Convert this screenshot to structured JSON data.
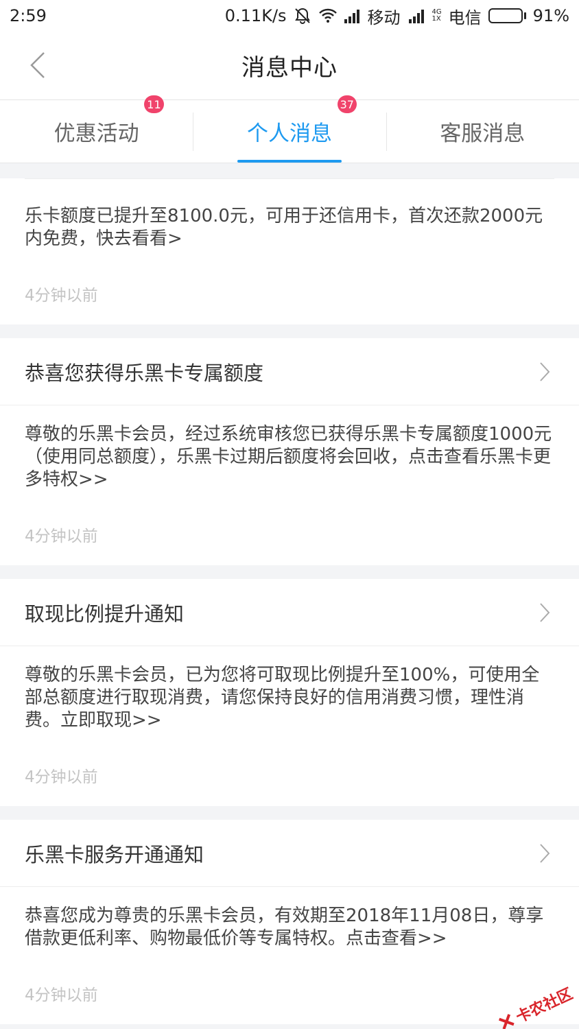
{
  "status_bar": {
    "time": "2:59",
    "speed": "0.11K/s",
    "carrier1": "移动",
    "net_tag_top": "4G",
    "net_tag_bottom": "1X",
    "carrier2": "电信",
    "battery": "91%",
    "battery_level": 0.91
  },
  "header": {
    "title": "消息中心"
  },
  "tabs": [
    {
      "label": "优惠活动",
      "badge": "11",
      "active": false
    },
    {
      "label": "个人消息",
      "badge": "37",
      "active": true
    },
    {
      "label": "客服消息",
      "badge": "",
      "active": false
    }
  ],
  "messages": [
    {
      "title": "",
      "body": "乐卡额度已提升至8100.0元，可用于还信用卡，首次还款2000元内免费，快去看看>",
      "time": "4分钟以前"
    },
    {
      "title": "恭喜您获得乐黑卡专属额度",
      "body": "尊敬的乐黑卡会员，经过系统审核您已获得乐黑卡专属额度1000元（使用同总额度），乐黑卡过期后额度将会回收，点击查看乐黑卡更多特权>>",
      "time": "4分钟以前"
    },
    {
      "title": "取现比例提升通知",
      "body": "尊敬的乐黑卡会员，已为您将可取现比例提升至100%，可使用全部总额度进行取现消费，请您保持良好的信用消费习惯，理性消费。立即取现>>",
      "time": "4分钟以前"
    },
    {
      "title": "乐黑卡服务开通通知",
      "body": "恭喜您成为尊贵的乐黑卡会员，有效期至2018年11月08日，尊享借款更低利率、购物最低价等专属特权。点击查看>>",
      "time": "4分钟以前"
    }
  ],
  "watermark": {
    "text": "卡农社区"
  },
  "colors": {
    "accent": "#1e9af0",
    "badge": "#f0436b",
    "watermark": "#d9252b"
  },
  "icons": {
    "back": "chevron-left-icon",
    "row_arrow": "chevron-right-icon",
    "mute": "bell-off-icon",
    "wifi": "wifi-icon",
    "signal": "signal-icon",
    "battery": "battery-icon"
  }
}
